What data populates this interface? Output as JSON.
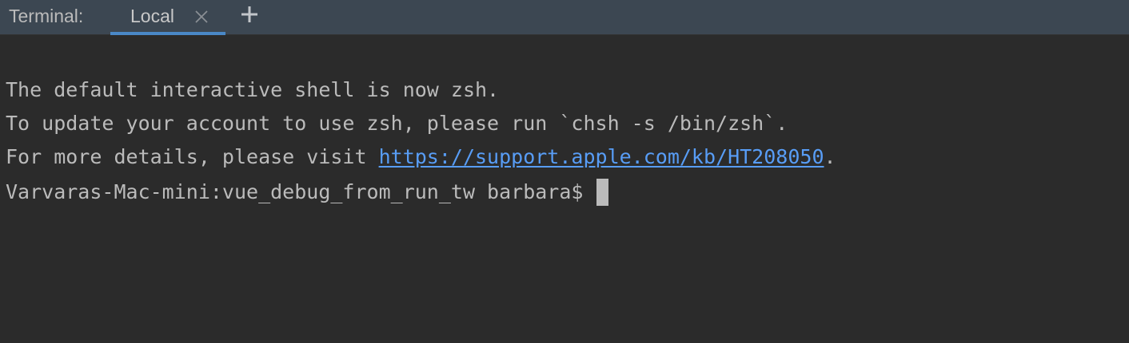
{
  "tool_window": {
    "title": "Terminal:"
  },
  "tabs": [
    {
      "label": "Local",
      "active": true
    }
  ],
  "terminal": {
    "lines": [
      "The default interactive shell is now zsh.",
      "To update your account to use zsh, please run `chsh -s /bin/zsh`."
    ],
    "details_prefix": "For more details, please visit ",
    "details_link": "https://support.apple.com/kb/HT208050",
    "details_suffix": ".",
    "prompt": "Varvaras-Mac-mini:vue_debug_from_run_tw barbara$ "
  },
  "colors": {
    "background": "#2b2b2b",
    "tabbar": "#3c4752",
    "text": "#bbbbbb",
    "link": "#589df6",
    "tab_underline": "#4a88c7"
  },
  "icons": {
    "close": "close-icon",
    "add": "plus-icon"
  }
}
